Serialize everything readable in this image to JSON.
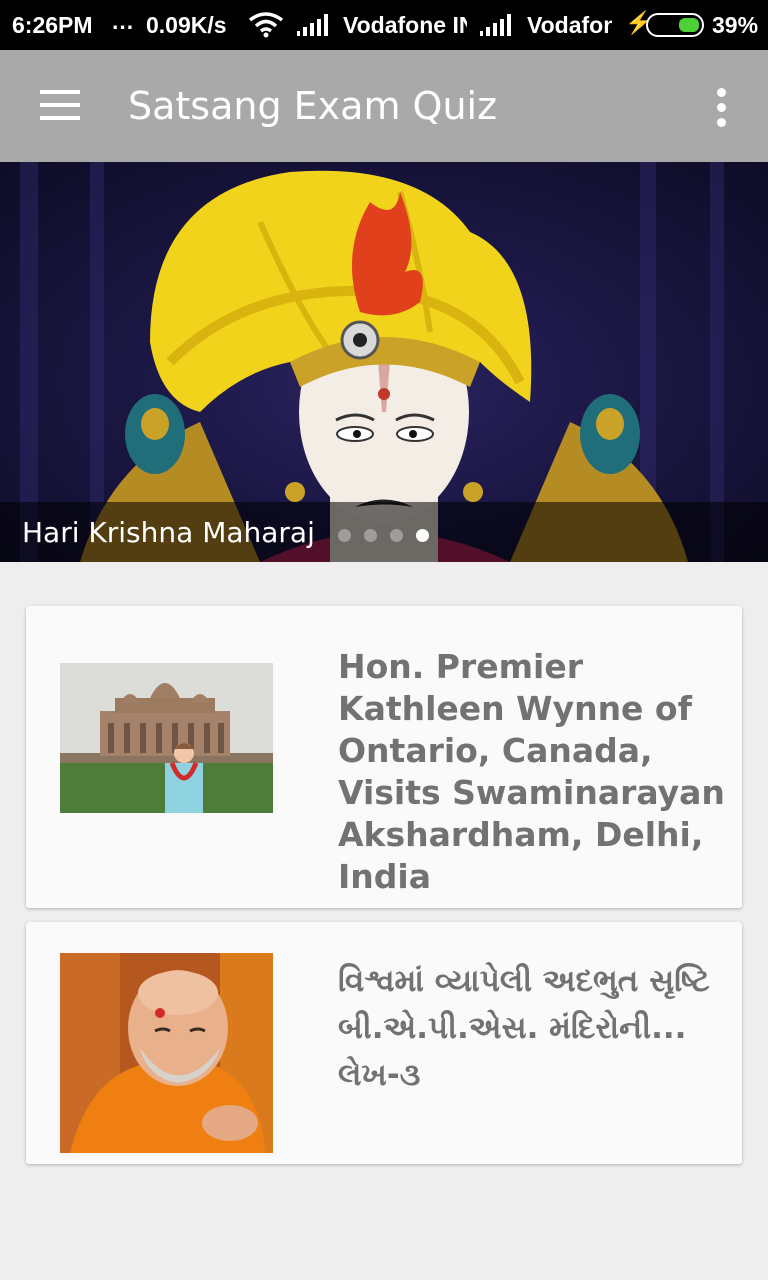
{
  "status_bar": {
    "time": "6:26PM",
    "dots": "...",
    "speed": "0.09K/s",
    "carrier1": "Vodafone IN",
    "carrier2": "Vodafone IN",
    "battery": "39%",
    "battery_color": "#4cd137"
  },
  "app_bar": {
    "title": "Satsang Exam Quiz",
    "menu_icon": "hamburger-icon",
    "overflow_icon": "more-vert-icon",
    "background": "#a9a9a9"
  },
  "banner": {
    "caption": "Hari Krishna Maharaj",
    "slide_count": 4,
    "active_slide": 4
  },
  "articles": [
    {
      "title": "Hon. Premier Kathleen Wynne of Ontario, Canada, Visits Swaminarayan Akshardham, Delhi, India"
    },
    {
      "title": "વિશ્વમાં વ્યાપેલી અદભુત સૃષ્ટિ બી.એ.પી.એસ. મંદિરોની... લેખ-૩"
    }
  ]
}
